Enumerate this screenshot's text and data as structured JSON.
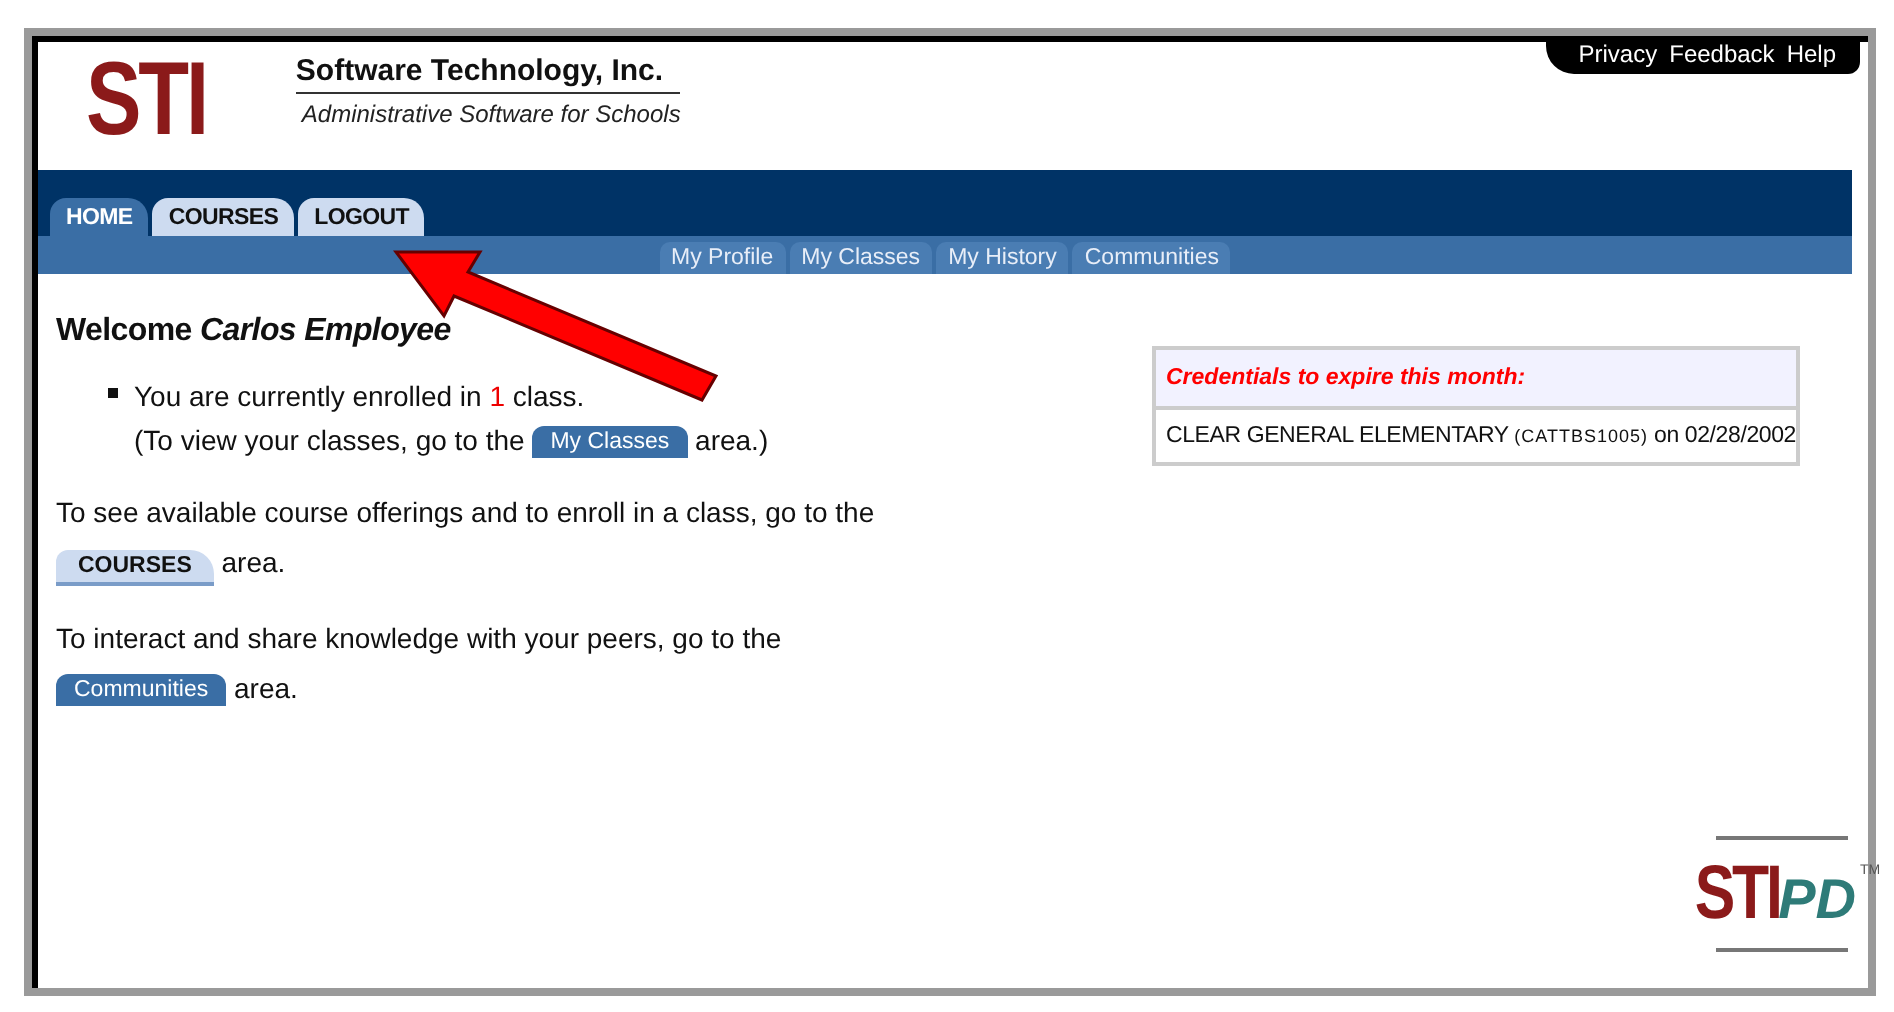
{
  "logo": {
    "text": "STI"
  },
  "company": {
    "name": "Software Technology, Inc.",
    "tagline": "Administrative Software for Schools"
  },
  "top_links": [
    "Privacy",
    "Feedback",
    "Help"
  ],
  "tabs": [
    {
      "label": "HOME",
      "selected": true
    },
    {
      "label": "COURSES",
      "selected": false
    },
    {
      "label": "LOGOUT",
      "selected": false
    }
  ],
  "subnav": [
    "My Profile",
    "My Classes",
    "My History",
    "Communities"
  ],
  "welcome": {
    "greeting": "Welcome",
    "name": "Carlos Employee"
  },
  "enrollment": {
    "before": "You are currently enrolled in",
    "count": "1",
    "after": "class.",
    "hint_before": "(To view your classes, go to the",
    "hint_button": "My Classes",
    "hint_after": "area.)"
  },
  "paragraphs": [
    {
      "text": "To see available course offerings and to enroll in a class, go to the",
      "button": {
        "label": "COURSES",
        "kind": "tab"
      },
      "after": "area."
    },
    {
      "text": "To interact and share knowledge with your peers, go to the",
      "button": {
        "label": "Communities",
        "kind": "pill"
      },
      "after": "area."
    }
  ],
  "credentials": {
    "title": "Credentials to expire this month:",
    "items": [
      {
        "name": "CLEAR GENERAL ELEMENTARY",
        "code": "(CATTBS1005)",
        "date": "on 02/28/2002"
      }
    ]
  },
  "footer_logo": {
    "main": "STI",
    "suffix": "PD",
    "mark": "TM"
  }
}
